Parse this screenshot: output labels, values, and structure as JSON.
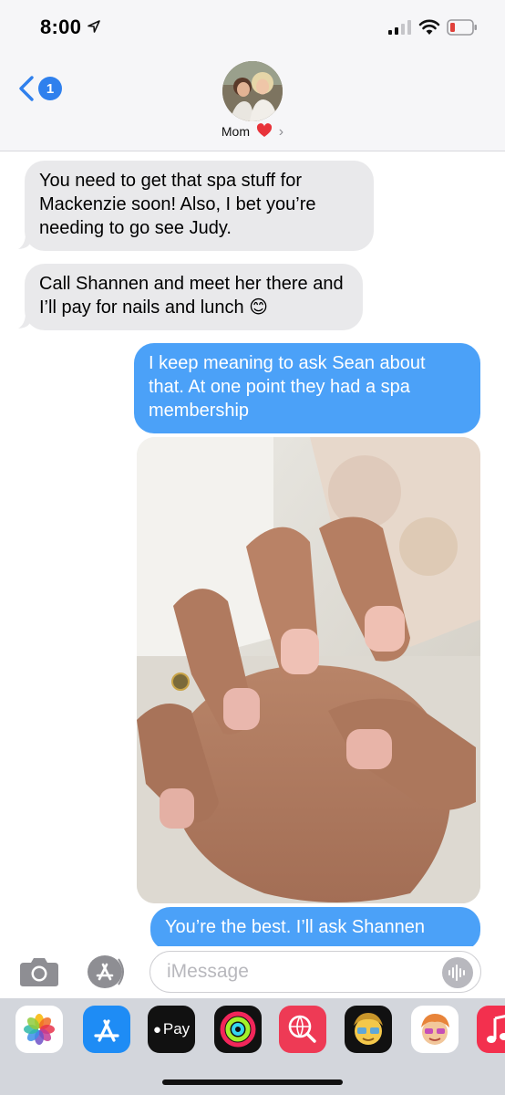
{
  "status_bar": {
    "time": "8:00",
    "icons": [
      "location-arrow-icon",
      "cellular-signal-icon",
      "wifi-icon",
      "battery-low-icon"
    ],
    "battery_color": "#e0403b"
  },
  "header": {
    "back_badge": "1",
    "contact_name": "Mom",
    "name_suffix_icon": "heart-icon",
    "accent": "#2f80ed"
  },
  "messages": [
    {
      "direction": "received",
      "text": "You need to get that spa stuff for Mackenzie soon! Also, I bet you’re needing to go see Judy."
    },
    {
      "direction": "received",
      "text": "Call Shannen and meet her there and I’ll pay for nails and lunch 😊"
    },
    {
      "direction": "sent",
      "text": "I keep meaning to ask Sean about that. At one point they had a spa membership"
    },
    {
      "direction": "sent",
      "type": "photo",
      "subject": "close-up photo of a hand showing short fingernails"
    },
    {
      "direction": "sent",
      "text": "You’re the best. I’ll ask Shannen"
    }
  ],
  "colors": {
    "sent_bubble": "#4ba1f8",
    "received_bubble": "#e9e9eb"
  },
  "input_bar": {
    "placeholder": "iMessage",
    "value": "",
    "icons": [
      "camera-icon",
      "app-store-icon",
      "audio-waveform-icon"
    ]
  },
  "app_drawer": {
    "apps": [
      {
        "name": "photos-app-icon"
      },
      {
        "name": "app-store-app-icon"
      },
      {
        "name": "apple-pay-app-icon",
        "label": "Pay"
      },
      {
        "name": "activity-app-icon"
      },
      {
        "name": "web-images-search-app-icon"
      },
      {
        "name": "memoji-app-icon"
      },
      {
        "name": "memoji-stickers-app-icon"
      },
      {
        "name": "music-app-icon"
      }
    ]
  }
}
